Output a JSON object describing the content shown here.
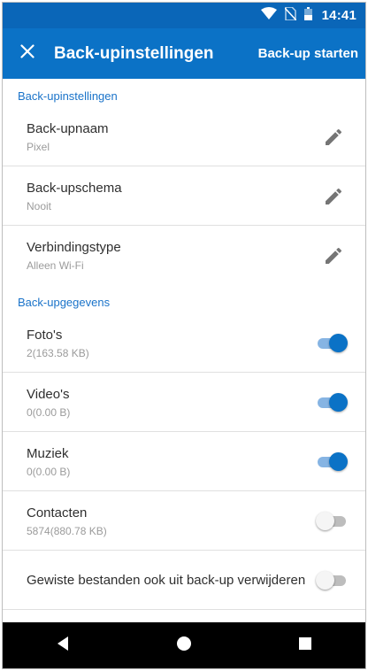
{
  "status_bar": {
    "time": "14:41",
    "icons": [
      "wifi-icon",
      "no-sim-icon",
      "battery-icon"
    ]
  },
  "app_bar": {
    "close_icon": "close-icon",
    "title": "Back-upinstellingen",
    "action_label": "Back-up starten"
  },
  "colors": {
    "primary": "#0b72c6",
    "status_bar": "#0a66b8",
    "section_header": "#1a73c9",
    "toggle_track_on": "#86b4e3",
    "toggle_track_off": "#bdbdbd"
  },
  "settings_section": {
    "header": "Back-upinstellingen",
    "items": [
      {
        "title": "Back-upnaam",
        "subtitle": "Pixel",
        "icon": "edit-icon"
      },
      {
        "title": "Back-upschema",
        "subtitle": "Nooit",
        "icon": "edit-icon"
      },
      {
        "title": "Verbindingstype",
        "subtitle": "Alleen Wi-Fi",
        "icon": "edit-icon"
      }
    ]
  },
  "data_section": {
    "header": "Back-upgegevens",
    "items": [
      {
        "title": "Foto's",
        "subtitle": "2(163.58 KB)",
        "enabled": true
      },
      {
        "title": "Video's",
        "subtitle": "0(0.00 B)",
        "enabled": true
      },
      {
        "title": "Muziek",
        "subtitle": "0(0.00 B)",
        "enabled": true
      },
      {
        "title": "Contacten",
        "subtitle": "5874(880.78 KB)",
        "enabled": false
      },
      {
        "title": "Gewiste bestanden ook uit back-up verwijderen",
        "enabled": false
      }
    ]
  },
  "nav_bar": {
    "buttons": [
      "back-icon",
      "home-icon",
      "recents-icon"
    ]
  }
}
